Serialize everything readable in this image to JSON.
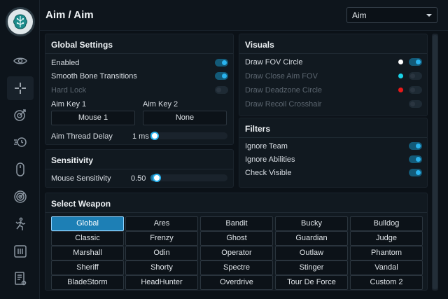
{
  "header": {
    "title": "Aim / Aim",
    "profile_select": "Aim"
  },
  "sidebar": {
    "items": [
      {
        "icon": "eye-icon"
      },
      {
        "icon": "crosshair-icon",
        "active": true
      },
      {
        "icon": "target-arrow-icon"
      },
      {
        "icon": "speed-clock-icon"
      },
      {
        "icon": "mouse-icon"
      },
      {
        "icon": "radar-icon"
      },
      {
        "icon": "running-person-icon"
      },
      {
        "icon": "sliders-icon"
      },
      {
        "icon": "settings-doc-icon"
      }
    ]
  },
  "global_settings": {
    "title": "Global Settings",
    "enabled": {
      "label": "Enabled",
      "on": true
    },
    "smooth": {
      "label": "Smooth Bone Transitions",
      "on": true
    },
    "hard_lock": {
      "label": "Hard Lock",
      "on": false,
      "disabled": true
    },
    "aim_key_1": {
      "label": "Aim Key 1",
      "value": "Mouse 1"
    },
    "aim_key_2": {
      "label": "Aim Key 2",
      "value": "None"
    },
    "thread_delay": {
      "label": "Aim Thread Delay",
      "value_text": "1 ms",
      "fraction": 0.0
    }
  },
  "sensitivity": {
    "title": "Sensitivity",
    "mouse": {
      "label": "Mouse Sensitivity",
      "value_text": "0.50",
      "fraction": 0.03
    }
  },
  "visuals": {
    "title": "Visuals",
    "items": [
      {
        "label": "Draw FOV Circle",
        "on": true,
        "disabled": false,
        "color": "#ffffff"
      },
      {
        "label": "Draw Close Aim FOV",
        "on": false,
        "disabled": true,
        "color": "#19d3e8"
      },
      {
        "label": "Draw Deadzone Circle",
        "on": false,
        "disabled": true,
        "color": "#e81919"
      },
      {
        "label": "Draw Recoil Crosshair",
        "on": false,
        "disabled": true,
        "color": ""
      }
    ]
  },
  "filters": {
    "title": "Filters",
    "items": [
      {
        "label": "Ignore Team",
        "on": true
      },
      {
        "label": "Ignore Abilities",
        "on": true
      },
      {
        "label": "Check Visible",
        "on": true
      }
    ]
  },
  "select_weapon": {
    "title": "Select Weapon",
    "selected": "Global",
    "rows": [
      [
        "Global",
        "Ares",
        "Bandit",
        "Bucky",
        "Bulldog"
      ],
      [
        "Classic",
        "Frenzy",
        "Ghost",
        "Guardian",
        "Judge"
      ],
      [
        "Marshall",
        "Odin",
        "Operator",
        "Outlaw",
        "Phantom"
      ],
      [
        "Sheriff",
        "Shorty",
        "Spectre",
        "Stinger",
        "Vandal"
      ],
      [
        "BladeStorm",
        "HeadHunter",
        "Overdrive",
        "Tour De Force",
        "Custom 2"
      ]
    ]
  },
  "colors": {
    "accent": "#2ab3ee",
    "selected_button": "#1d7fb5"
  }
}
